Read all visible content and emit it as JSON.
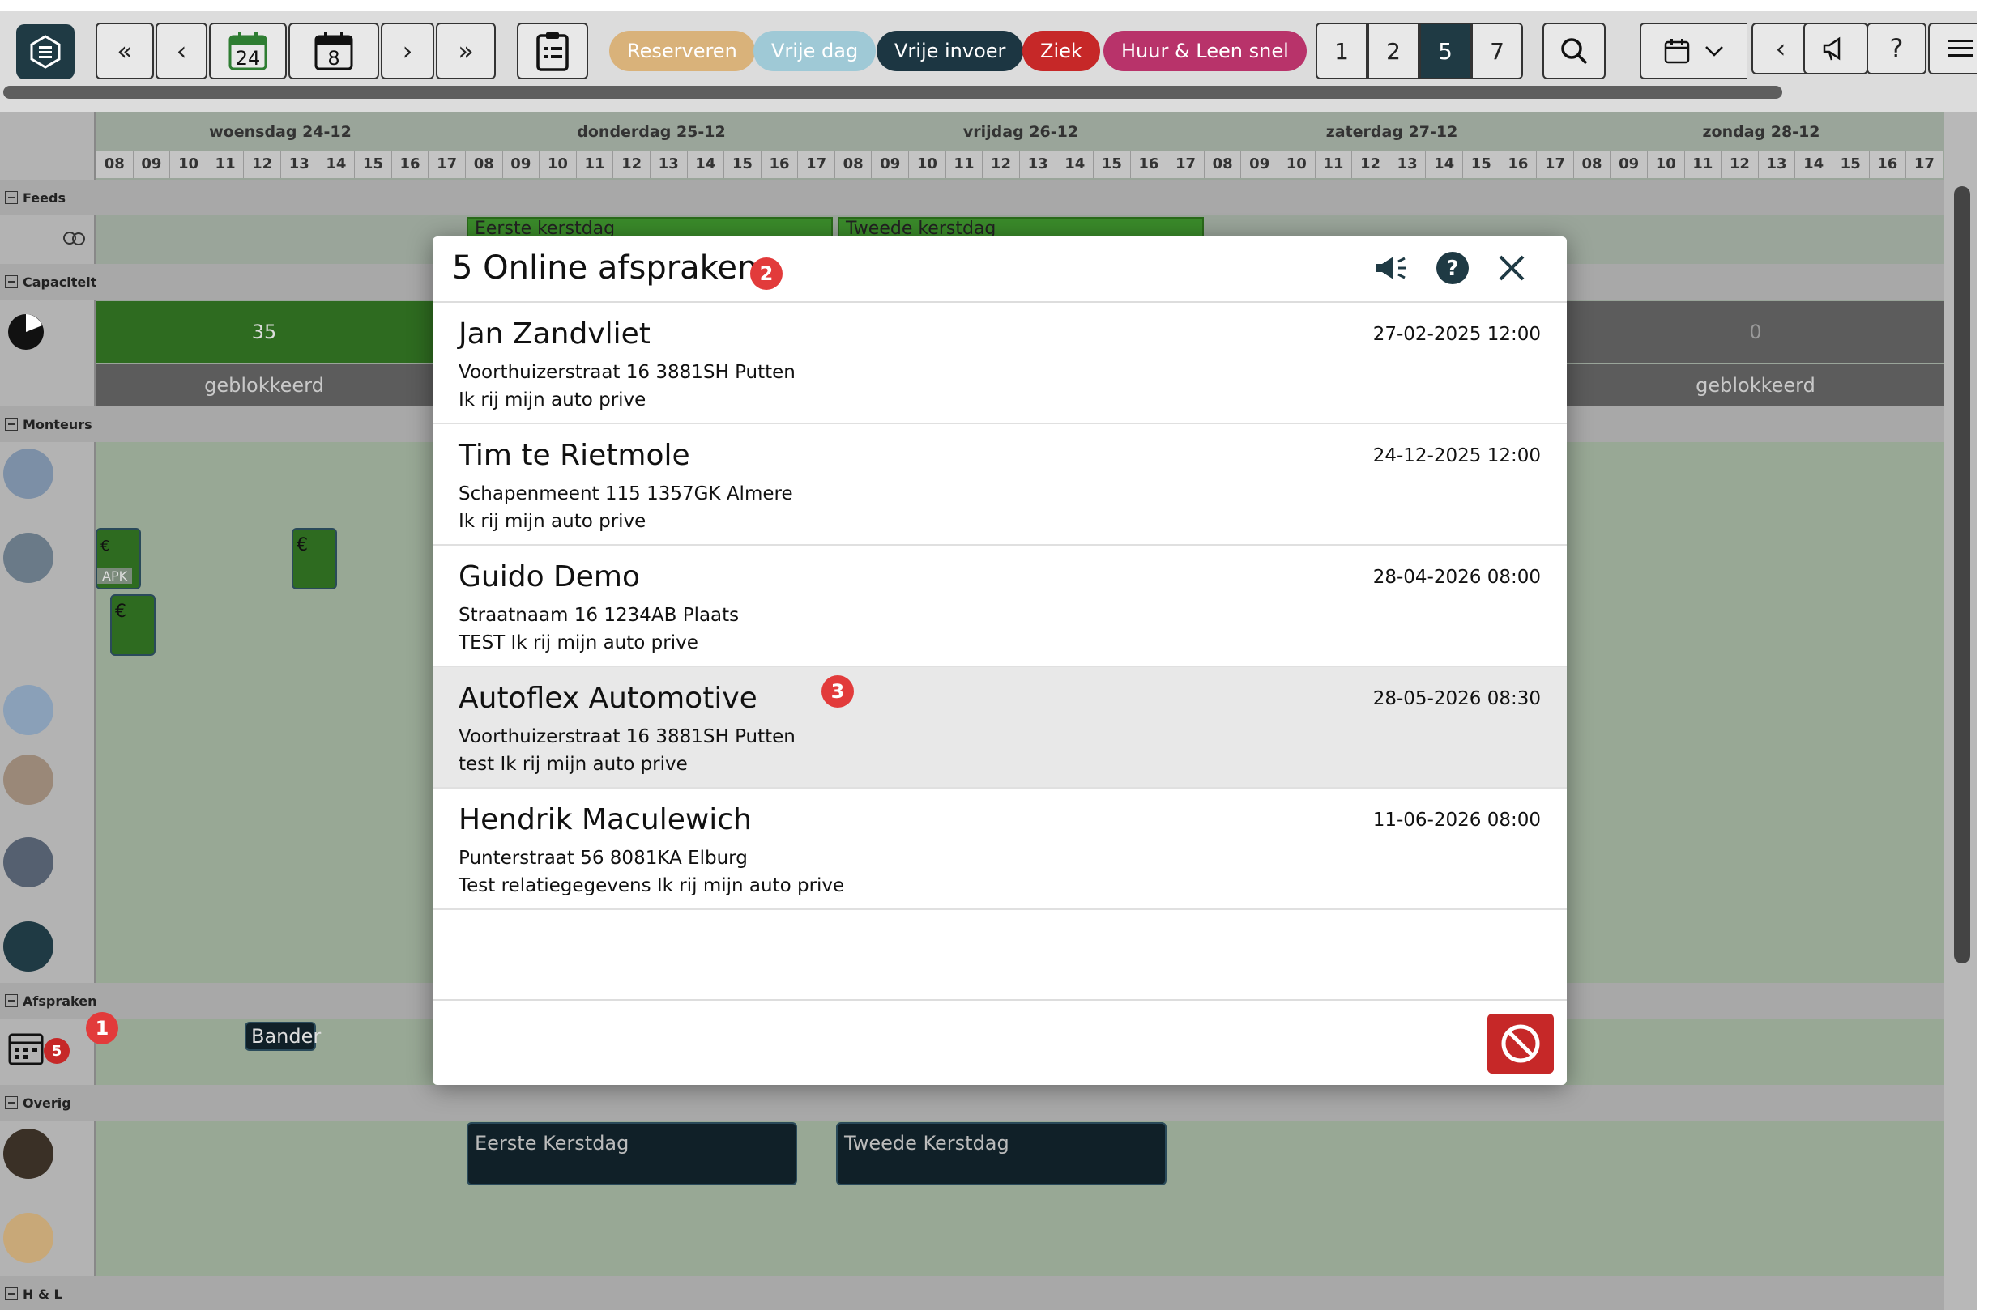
{
  "toolbar": {
    "date_today": "24",
    "date_week": "8",
    "pills": [
      {
        "label": "Reserveren",
        "color": "#d9b27a"
      },
      {
        "label": "Vrije dag",
        "color": "#9fc9d6"
      },
      {
        "label": "Vrije invoer",
        "color": "#1c3642"
      },
      {
        "label": "Ziek",
        "color": "#c62828"
      },
      {
        "label": "Huur & Leen snel",
        "color": "#b8336a"
      }
    ],
    "day_options": [
      "1",
      "2",
      "5",
      "7"
    ],
    "selected_day_option": "5"
  },
  "calendar": {
    "days": [
      "woensdag 24-12",
      "donderdag 25-12",
      "vrijdag 26-12",
      "zaterdag 27-12",
      "zondag 28-12"
    ],
    "hours": [
      "08",
      "09",
      "10",
      "11",
      "12",
      "13",
      "14",
      "15",
      "16",
      "17"
    ],
    "sections": {
      "feeds": "Feeds",
      "capaciteit": "Capaciteit",
      "monteurs": "Monteurs",
      "afspraken": "Afspraken",
      "overig": "Overig",
      "hl": "H & L"
    },
    "capacity_value": "35",
    "capacity_value_end": "0",
    "blocked_label": "geblokkeerd",
    "holiday_top_1": "Eerste kerstdag",
    "holiday_top_2": "Tweede kerstdag",
    "holiday_bottom_1": "Eerste Kerstdag",
    "holiday_bottom_2": "Tweede Kerstdag",
    "apk_tag": "APK",
    "bander_label": "Bander",
    "euro_sign": "€",
    "afspraken_count": "5"
  },
  "annotations": {
    "marker_1": "1",
    "marker_2": "2",
    "marker_3": "3"
  },
  "modal": {
    "title": "5 Online afspraken",
    "items": [
      {
        "name": "Jan Zandvliet",
        "address": "Voorthuizerstraat 16 3881SH Putten",
        "note": "Ik rij mijn auto prive",
        "datetime": "27-02-2025 12:00"
      },
      {
        "name": "Tim te Rietmole",
        "address": "Schapenmeent 115 1357GK Almere",
        "note": "Ik rij mijn auto prive",
        "datetime": "24-12-2025 12:00"
      },
      {
        "name": "Guido Demo",
        "address": "Straatnaam 16 1234AB Plaats",
        "note": "TEST Ik rij mijn auto prive",
        "datetime": "28-04-2026 08:00"
      },
      {
        "name": "Autoflex Automotive",
        "address": "Voorthuizerstraat 16 3881SH Putten",
        "note": "test Ik rij mijn auto prive",
        "datetime": "28-05-2026 08:30"
      },
      {
        "name": "Hendrik Maculewich",
        "address": "Punterstraat 56 8081KA Elburg",
        "note": "Test relatiegegevens Ik rij mijn auto prive",
        "datetime": "11-06-2026 08:00"
      }
    ]
  }
}
